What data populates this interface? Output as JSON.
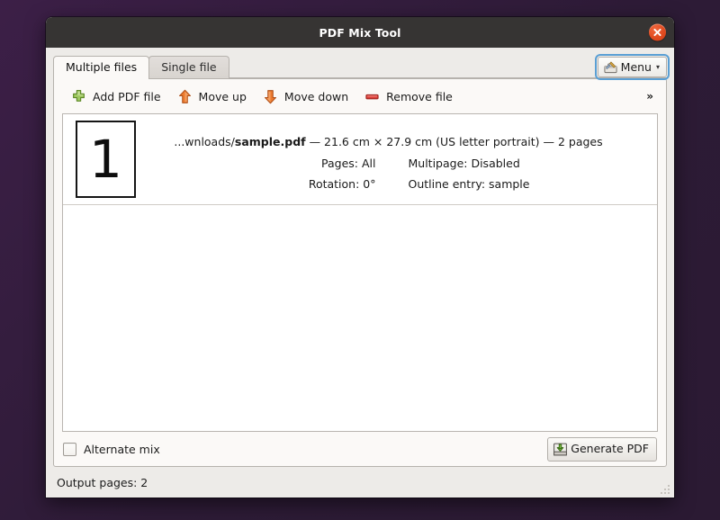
{
  "window": {
    "title": "PDF Mix Tool",
    "close_icon": "close-icon"
  },
  "tabs": [
    {
      "label": "Multiple files",
      "active": true
    },
    {
      "label": "Single file",
      "active": false
    }
  ],
  "menu_button": {
    "label": "Menu",
    "icon": "toolbox-icon",
    "caret": "▾",
    "focused": true
  },
  "toolbar": {
    "items": [
      {
        "label": "Add PDF file",
        "icon": "plus-icon"
      },
      {
        "label": "Move up",
        "icon": "arrow-up-icon"
      },
      {
        "label": "Move down",
        "icon": "arrow-down-icon"
      },
      {
        "label": "Remove file",
        "icon": "minus-icon"
      }
    ],
    "overflow_label": "»"
  },
  "file_list": {
    "rows": [
      {
        "thumbnail_number": "1",
        "path_prefix": "...wnloads/",
        "file_name": "sample.pdf",
        "summary_suffix": " — 21.6 cm × 27.9 cm (US letter portrait) — 2 pages",
        "pages_label": "Pages: All",
        "multipage_label": "Multipage: Disabled",
        "rotation_label": "Rotation: 0°",
        "outline_label": "Outline entry: sample"
      }
    ]
  },
  "bottom": {
    "alternate_mix_label": "Alternate mix",
    "alternate_mix_checked": false,
    "generate_label": "Generate PDF",
    "generate_icon": "save-download-icon"
  },
  "statusbar": {
    "output_pages": "Output pages: 2"
  },
  "colors": {
    "titlebar": "#363433",
    "close_button": "#e04b20",
    "desktop": "#2e1c38",
    "focus_ring": "#5a9fd4",
    "add_icon_green": "#8db84a",
    "move_icon_orange": "#e8762c",
    "remove_icon_red": "#d83a35"
  }
}
